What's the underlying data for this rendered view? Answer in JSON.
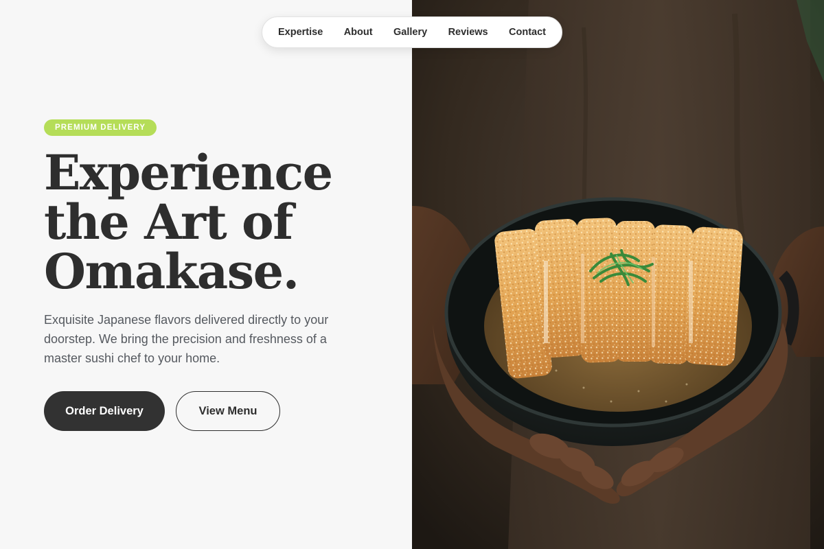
{
  "nav": {
    "items": [
      {
        "label": "Expertise"
      },
      {
        "label": "About"
      },
      {
        "label": "Gallery"
      },
      {
        "label": "Reviews"
      },
      {
        "label": "Contact"
      }
    ]
  },
  "hero": {
    "badge": "PREMIUM DELIVERY",
    "headline": [
      "Experience",
      "the Art of",
      "Omakase."
    ],
    "description": "Exquisite Japanese flavors delivered directly to your doorstep. We bring the precision and freshness of a master sushi chef to your home.",
    "primary_cta": "Order Delivery",
    "secondary_cta": "View Menu"
  },
  "image": {
    "subject": "katsu-curry-bowl"
  },
  "colors": {
    "badge_bg": "#b5dd58",
    "primary_button": "#323232",
    "text_dark": "#2e2e2e",
    "text_muted": "#55595f",
    "background": "#f7f7f7"
  }
}
